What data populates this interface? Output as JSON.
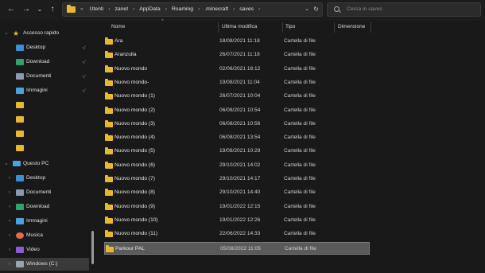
{
  "toolbar": {
    "back_icon": "←",
    "forward_icon": "→",
    "recent_icon": "⌄",
    "up_icon": "↑",
    "address": {
      "overflow": "«",
      "crumbs": [
        "Utenti",
        "zanet",
        "AppData",
        "Roaming",
        ".minecraft",
        "saves"
      ],
      "separator": "›",
      "dropdown_icon": "⌄",
      "refresh_icon": "↻"
    },
    "search_placeholder": "Cerca in saves"
  },
  "sidebar": {
    "quick_access": {
      "chevron": "⌄",
      "label": "Accesso rapido",
      "items": [
        {
          "label": "Desktop",
          "icon": "desktop-icon",
          "color": "#3a8fd6",
          "pinned": true
        },
        {
          "label": "Download",
          "icon": "download-icon",
          "color": "#2fa36b",
          "pinned": true
        },
        {
          "label": "Documenti",
          "icon": "documents-icon",
          "color": "#8a9bb0",
          "pinned": true
        },
        {
          "label": "Immagini",
          "icon": "pictures-icon",
          "color": "#4aa3df",
          "pinned": true
        },
        {
          "label": "",
          "icon": "folder-icon",
          "color": "#e8b830",
          "pinned": false
        },
        {
          "label": "",
          "icon": "folder-icon",
          "color": "#e8b830",
          "pinned": false
        },
        {
          "label": "",
          "icon": "folder-icon",
          "color": "#e8b830",
          "pinned": false
        },
        {
          "label": "",
          "icon": "folder-icon",
          "color": "#e8b830",
          "pinned": false
        }
      ],
      "pin_icon": "📌"
    },
    "this_pc": {
      "chevron": "⌄",
      "label": "Questo PC",
      "items": [
        {
          "label": "Desktop",
          "icon": "desktop-icon",
          "color": "#3a8fd6"
        },
        {
          "label": "Documenti",
          "icon": "documents-icon",
          "color": "#8a9bb0"
        },
        {
          "label": "Download",
          "icon": "download-icon",
          "color": "#2fa36b"
        },
        {
          "label": "Immagini",
          "icon": "pictures-icon",
          "color": "#4aa3df"
        },
        {
          "label": "Musica",
          "icon": "music-icon",
          "color": "#e06c4c"
        },
        {
          "label": "Video",
          "icon": "video-icon",
          "color": "#8a5cd6"
        },
        {
          "label": "Windows (C:)",
          "icon": "drive-icon",
          "color": "#9aa4ad",
          "selected": true
        }
      ],
      "child_chevron": "›"
    }
  },
  "columns": {
    "name": "Nome",
    "modified": "Ultima modifica",
    "type": "Tipo",
    "size": "Dimensione",
    "sort_icon": "^"
  },
  "files": [
    {
      "name": "Ara",
      "modified": "18/08/2021 11:18",
      "type": "Cartella di file"
    },
    {
      "name": "Aranzulla",
      "modified": "26/07/2021 11:18",
      "type": "Cartella di file"
    },
    {
      "name": "Nuovo mondo",
      "modified": "02/06/2021 18:12",
      "type": "Cartella di file"
    },
    {
      "name": "Nuovo mondo-",
      "modified": "19/08/2021 11:04",
      "type": "Cartella di file"
    },
    {
      "name": "Nuovo mondo (1)",
      "modified": "26/07/2021 10:04",
      "type": "Cartella di file"
    },
    {
      "name": "Nuovo mondo (2)",
      "modified": "06/08/2021 10:54",
      "type": "Cartella di file"
    },
    {
      "name": "Nuovo mondo (3)",
      "modified": "06/08/2021 10:56",
      "type": "Cartella di file"
    },
    {
      "name": "Nuovo mondo (4)",
      "modified": "06/08/2021 13:54",
      "type": "Cartella di file"
    },
    {
      "name": "Nuovo mondo (5)",
      "modified": "19/08/2021 10:29",
      "type": "Cartella di file"
    },
    {
      "name": "Nuovo mondo (6)",
      "modified": "29/10/2021 14:02",
      "type": "Cartella di file"
    },
    {
      "name": "Nuovo mondo (7)",
      "modified": "29/10/2021 14:17",
      "type": "Cartella di file"
    },
    {
      "name": "Nuovo mondo (8)",
      "modified": "29/10/2021 14:40",
      "type": "Cartella di file"
    },
    {
      "name": "Nuovo mondo (9)",
      "modified": "19/01/2022 12:15",
      "type": "Cartella di file"
    },
    {
      "name": "Nuovo mondo (10)",
      "modified": "19/01/2022 12:26",
      "type": "Cartella di file"
    },
    {
      "name": "Nuovo mondo (11)",
      "modified": "22/06/2022 14:33",
      "type": "Cartella di file"
    },
    {
      "name": "Parkour PAL",
      "modified": "05/08/2022 11:05",
      "type": "Cartella di file",
      "selected": true
    }
  ]
}
